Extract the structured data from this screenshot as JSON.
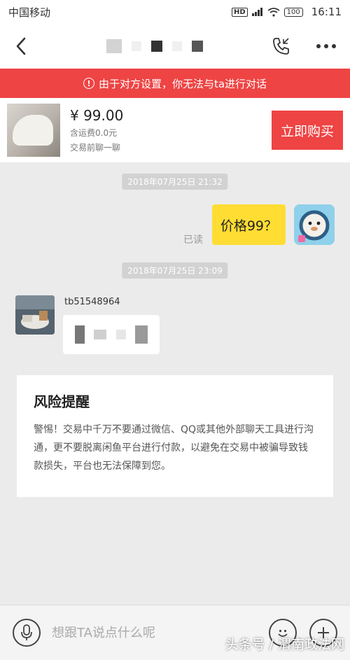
{
  "status_bar": {
    "carrier": "中国移动",
    "hd": "HD",
    "battery": "100",
    "time": "16:11"
  },
  "nav": {
    "back_icon": "chevron-left-icon",
    "call_icon": "phone-icon",
    "more_icon": "more-dots-icon"
  },
  "alert": {
    "icon": "!",
    "text": "由于对方设置，你无法与ta进行对话"
  },
  "product": {
    "price": "¥ 99.00",
    "shipping": "含运费0.0元",
    "note": "交易前聊一聊",
    "buy_label": "立即购买"
  },
  "chat": {
    "timestamp_1": "2018年07月25日 21:32",
    "outgoing_text": "价格99？",
    "read_status": "已读",
    "timestamp_2": "2018年07月25日 23:09",
    "sender_name": "tb51548964"
  },
  "risk": {
    "title": "风险提醒",
    "body": "警惕！交易中千万不要通过微信、QQ或其他外部聊天工具进行沟通，更不要脱离闲鱼平台进行付款，以避免在交易中被骗导致钱款损失，平台也无法保障到您。"
  },
  "input": {
    "placeholder": "想跟TA说点什么呢",
    "voice_icon": "microphone-icon",
    "emoji_icon": "emoji-icon",
    "add_icon": "plus-icon"
  },
  "watermark": "头条号 / 渭南政法网",
  "colors": {
    "accent_red": "#ee4444",
    "bubble_yellow": "#ffdd33"
  }
}
